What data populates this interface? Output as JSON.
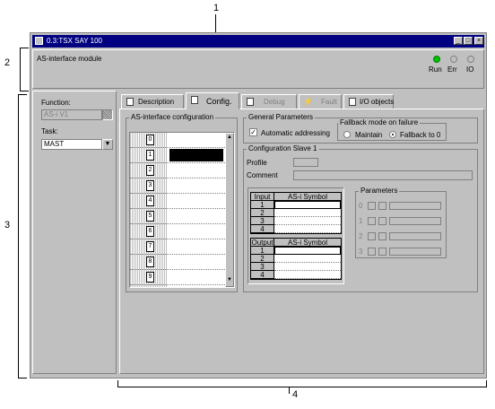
{
  "callouts": {
    "c1": "1",
    "c2": "2",
    "c3": "3",
    "c4": "4"
  },
  "window": {
    "title": "0.3:TSX SAY 100"
  },
  "header": {
    "module_name": "AS-interface module",
    "leds": [
      {
        "label": "Run",
        "color": "#00c000"
      },
      {
        "label": "Err",
        "color": "#c0c0c0"
      },
      {
        "label": "IO",
        "color": "#c0c0c0"
      }
    ]
  },
  "left_panel": {
    "function_label": "Function:",
    "function_value": "AS-i V1",
    "task_label": "Task:",
    "task_value": "MAST"
  },
  "tabs": [
    {
      "label": "Description",
      "active": false
    },
    {
      "label": "Config.",
      "active": true
    },
    {
      "label": "Debug",
      "active": false
    },
    {
      "label": "Fault",
      "active": false
    },
    {
      "label": "I/O objects",
      "active": false
    }
  ],
  "config": {
    "asi_config_title": "AS-interface configuration",
    "slots": [
      "0",
      "1",
      "2",
      "3",
      "4",
      "5",
      "6",
      "7",
      "8",
      "9"
    ],
    "general_params_title": "General Parameters",
    "auto_addressing_label": "Automatic addressing",
    "auto_addressing_checked": true,
    "fallback_title": "Fallback mode on failure",
    "fallback_options": [
      "Maintain",
      "Fallback to 0"
    ],
    "fallback_selected": "Fallback to 0",
    "slave_title": "Configuration Slave 1",
    "profile_label": "Profile",
    "comment_label": "Comment",
    "input_table": {
      "headers": [
        "Input",
        "AS-i Symbol"
      ],
      "rows": [
        "1",
        "2",
        "3",
        "4"
      ]
    },
    "output_table": {
      "headers": [
        "Output",
        "AS-i Symbol"
      ],
      "rows": [
        "1",
        "2",
        "3",
        "4"
      ]
    },
    "parameters_title": "Parameters",
    "parameters": [
      "0",
      "1",
      "2",
      "3"
    ]
  }
}
